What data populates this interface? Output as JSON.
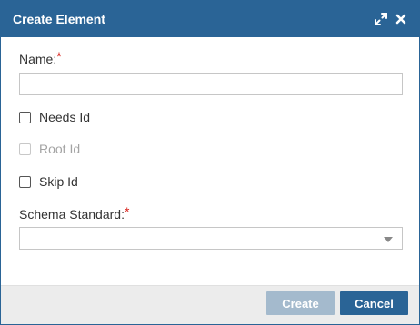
{
  "dialog": {
    "title": "Create Element",
    "icons": {
      "maximize": "expand-icon",
      "close": "close-icon"
    }
  },
  "form": {
    "name_label": "Name:",
    "name_required": "*",
    "name_value": "",
    "checkboxes": [
      {
        "label": "Needs Id",
        "checked": false,
        "disabled": false
      },
      {
        "label": "Root Id",
        "checked": false,
        "disabled": true
      },
      {
        "label": "Skip Id",
        "checked": false,
        "disabled": false
      }
    ],
    "schema_label": "Schema Standard:",
    "schema_required": "*",
    "schema_value": ""
  },
  "footer": {
    "create_label": "Create",
    "cancel_label": "Cancel"
  },
  "colors": {
    "primary": "#2a6496",
    "primary_disabled": "#a4bacd",
    "required": "#d9231d"
  }
}
